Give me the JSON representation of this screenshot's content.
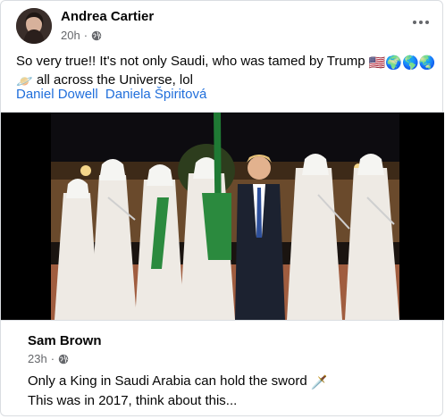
{
  "post": {
    "author": "Andrea Cartier",
    "time": "20h",
    "separator": "·",
    "privacy_icon": "globe-icon",
    "text_line1": "So very true!! It's not only Saudi, who was tamed by Trump",
    "text_line1_emojis": [
      "🇺🇸",
      "🌍",
      "🌎",
      "🌏"
    ],
    "text_line2_emoji": "🪐",
    "text_line2": "all across the Universe, lol",
    "tags": [
      "Daniel Dowell",
      "Daniela Špiritová"
    ],
    "more_icon": "more-horizontal-icon"
  },
  "shared_post": {
    "author": "Sam Brown",
    "time": "23h",
    "separator": "·",
    "privacy_icon": "globe-icon",
    "text_line1": "Only a King in Saudi Arabia can hold the sword",
    "text_line1_emoji": "🗡️",
    "text_line2": "This was in 2017, think about this..."
  },
  "colors": {
    "link": "#216fdb",
    "meta": "#65676b",
    "border": "#dadde1",
    "text": "#050505"
  }
}
